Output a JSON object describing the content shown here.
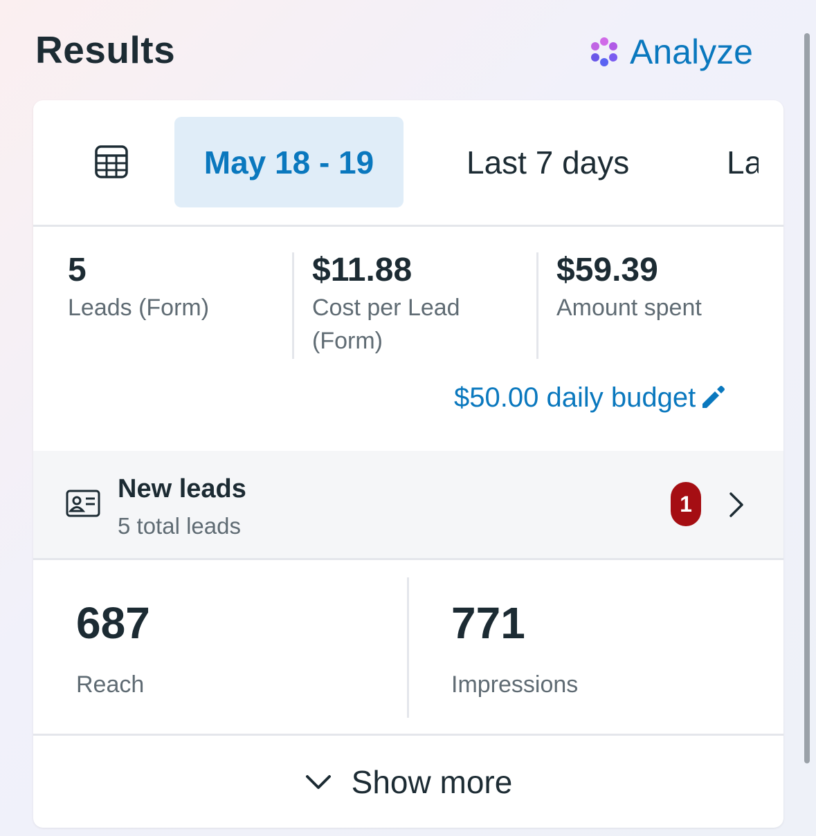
{
  "header": {
    "title": "Results",
    "analyze_label": "Analyze",
    "analyze_icon": "sparkle-flower-icon"
  },
  "tabs": {
    "calendar_icon": "calendar-table-icon",
    "items": [
      {
        "label": "May 18 - 19",
        "active": true
      },
      {
        "label": "Last 7 days",
        "active": false
      },
      {
        "label": "La",
        "active": false
      }
    ]
  },
  "metrics": [
    {
      "value": "5",
      "label": "Leads (Form)"
    },
    {
      "value": "$11.88",
      "label": "Cost per Lead (Form)"
    },
    {
      "value": "$59.39",
      "label": "Amount spent"
    }
  ],
  "budget": {
    "label": "$50.00 daily budget",
    "icon": "pencil-edit-icon"
  },
  "leads": {
    "icon": "contact-card-icon",
    "title": "New leads",
    "subtitle": "5 total leads",
    "badge_count": "1",
    "badge_color": "#a50e13"
  },
  "stats": [
    {
      "value": "687",
      "label": "Reach"
    },
    {
      "value": "771",
      "label": "Impressions"
    }
  ],
  "show_more": {
    "label": "Show more",
    "icon": "chevron-down-icon"
  },
  "colors": {
    "accent": "#0a78be",
    "text": "#1c2b33",
    "muted": "#5f6b73",
    "tab_active_bg": "#e0edf8"
  }
}
